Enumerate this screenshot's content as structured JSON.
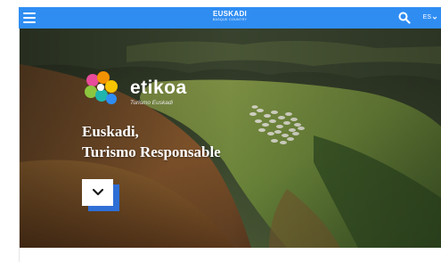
{
  "header": {
    "brand_title": "EUSKADI",
    "brand_subtitle": "BASQUE COUNTRY",
    "menu_icon": "hamburger-menu-icon",
    "search_icon": "search-icon",
    "language_label": "ES",
    "language_icon": "chevron-down-icon",
    "bar_color": "#2f8df2"
  },
  "hero": {
    "logo_word": "etikoa",
    "logo_subtitle": "Turismo Euskadi",
    "title_line1": "Euskadi,",
    "title_line2": "Turismo Responsable",
    "scroll_icon": "chevron-down-icon",
    "accent_color": "#2f6fd6"
  }
}
